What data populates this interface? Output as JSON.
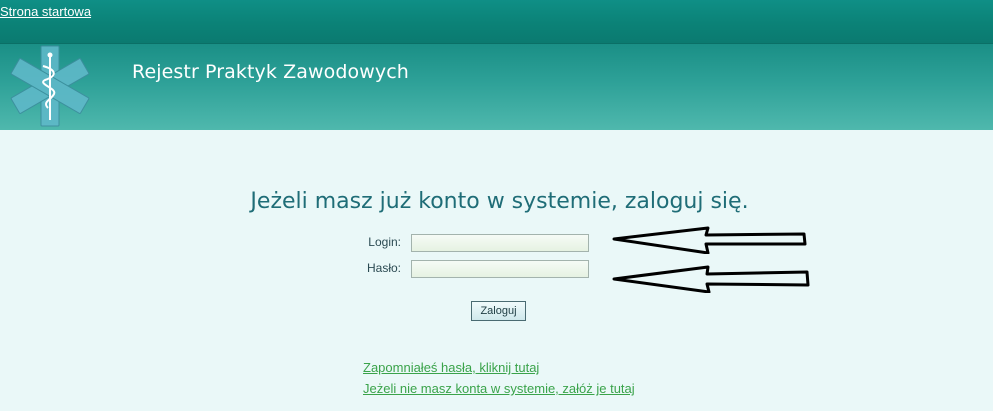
{
  "nav": {
    "home_link": "Strona startowa"
  },
  "header": {
    "title": "Rejestr Praktyk Zawodowych",
    "logo_icon": "star-of-life-icon"
  },
  "login": {
    "heading": "Jeżeli masz już konto w systemie, zaloguj się.",
    "login_label": "Login:",
    "login_value": "",
    "password_label": "Hasło:",
    "password_value": "",
    "submit_label": "Zaloguj"
  },
  "links": {
    "forgot_password": "Zapomniałeś hasła, kliknij tutaj",
    "register": "Jeżeli nie masz konta w systemie, załóż je tutaj"
  },
  "annotations": {
    "arrow_icon": "left-arrow-icon"
  },
  "colors": {
    "topbar": "#0b8277",
    "header_gradient_light": "#4fb8ad",
    "background": "#eaf8f8",
    "heading_text": "#1f6d77",
    "link_text": "#3aa34a"
  }
}
